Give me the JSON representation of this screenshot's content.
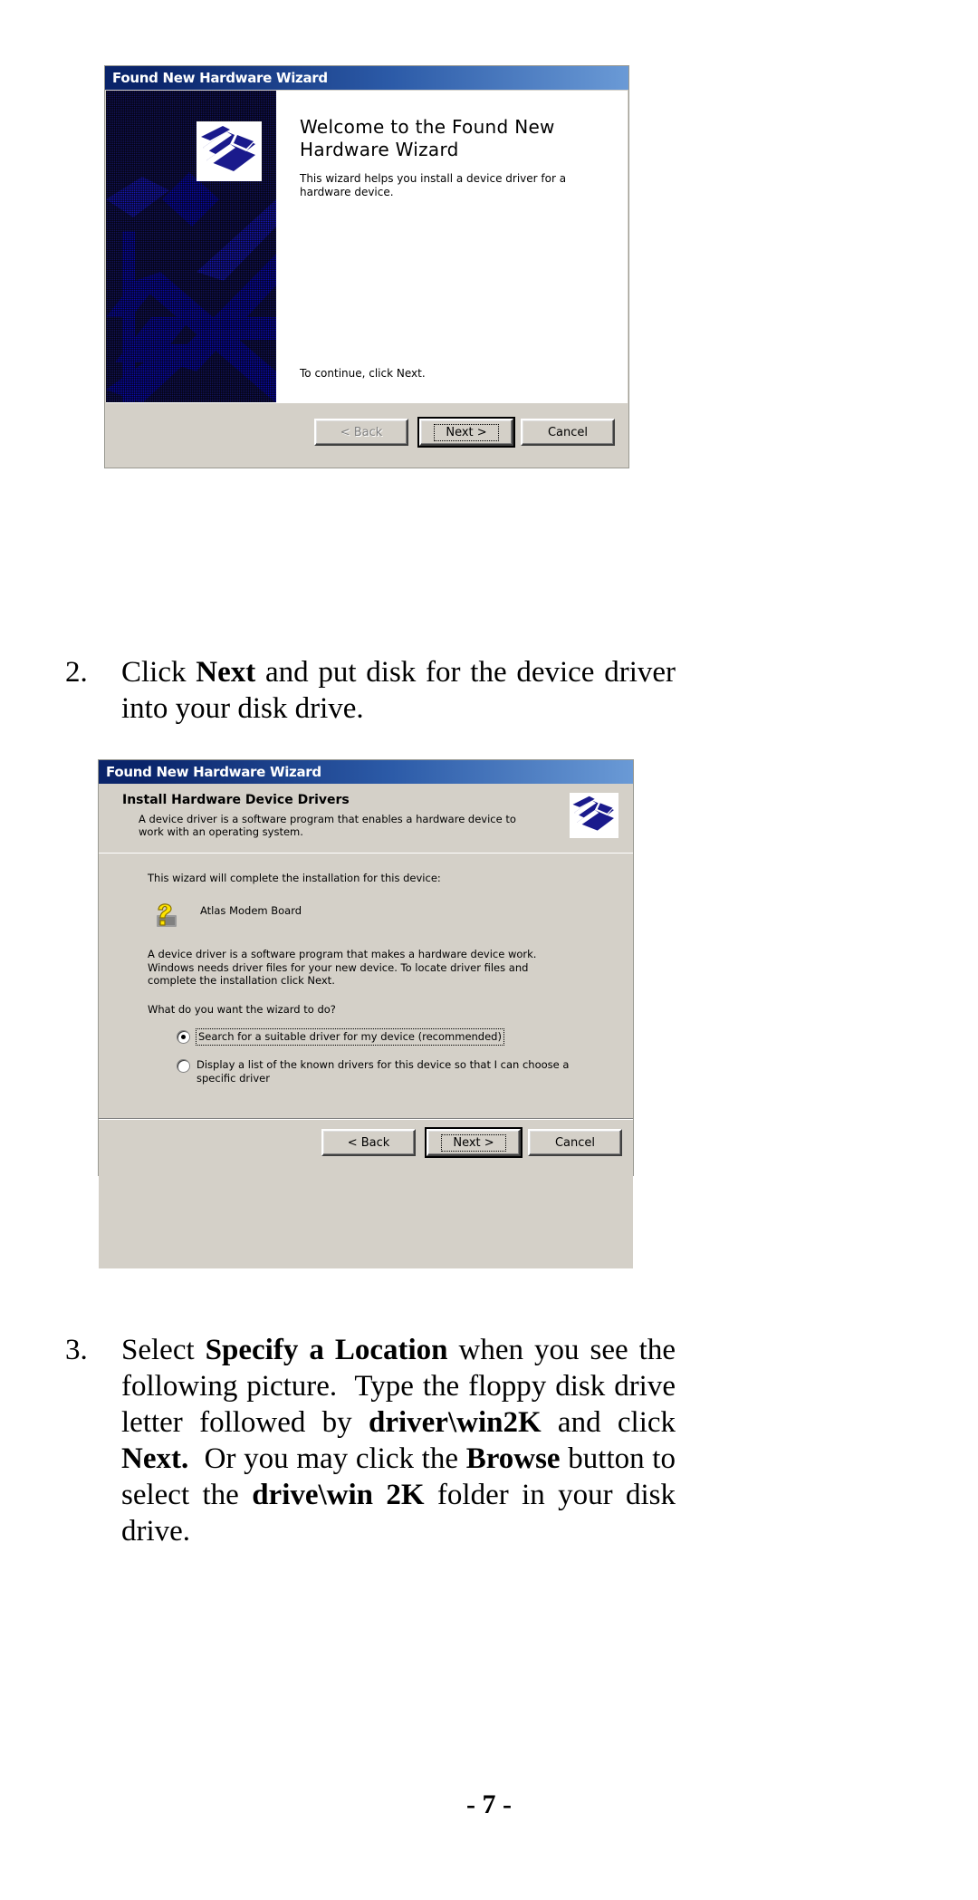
{
  "page": {
    "number_label": "- 7 -"
  },
  "dialog_welcome": {
    "title": "Found New Hardware Wizard",
    "heading": "Welcome to the Found New Hardware Wizard",
    "body": "This wizard helps you install a device driver for a hardware device.",
    "continue_text": "To continue, click Next.",
    "buttons": {
      "back": "< Back",
      "back_accel": "B",
      "next": "Next >",
      "next_accel": "N",
      "cancel": "Cancel"
    },
    "icons": {
      "banner": "hardware-wizard-banner",
      "welcome": "hardware-wizard-icon"
    }
  },
  "dialog_install": {
    "title": "Found New Hardware Wizard",
    "heading": "Install Hardware Device Drivers",
    "subheading": "A device driver is a software program that enables a hardware device to work with an operating system.",
    "intro": "This wizard will complete the installation for this device:",
    "device_name": "Atlas Modem Board",
    "paragraph": "A device driver is a software program that makes a hardware device work. Windows needs driver files for your new device. To locate driver files and complete the installation click Next.",
    "question": "What do you want the wizard to do?",
    "options": [
      {
        "label": "Search for a suitable driver for my device (recommended)",
        "accel": "S",
        "selected": true
      },
      {
        "label": "Display a list of the known drivers for this device so that I can choose a specific driver",
        "accel": "D",
        "selected": false
      }
    ],
    "buttons": {
      "back": "< Back",
      "back_accel": "B",
      "next": "Next >",
      "next_accel": "N",
      "cancel": "Cancel"
    },
    "icons": {
      "header": "hardware-wizard-icon",
      "device": "unknown-device-question-icon"
    }
  },
  "steps": [
    {
      "number": "2.",
      "html": "Click <b>Next</b> and put disk for the device driver into your disk drive."
    },
    {
      "number": "3.",
      "html": "Select <b>Specify a Location</b> when you see the following picture.&nbsp; Type the floppy disk drive letter followed by <b>driver\\win2K</b> and click <b>Next.</b>&nbsp; Or you may click the <b>Browse</b> button to select the <b>drive\\win 2K</b> folder in your disk drive."
    }
  ],
  "colors": {
    "titlebar_start": "#0a246a",
    "titlebar_end": "#6a9ad6",
    "dialog_face": "#d4d0c8",
    "banner_blue": "#121259",
    "device_icon_yellow": "#ffe400"
  }
}
